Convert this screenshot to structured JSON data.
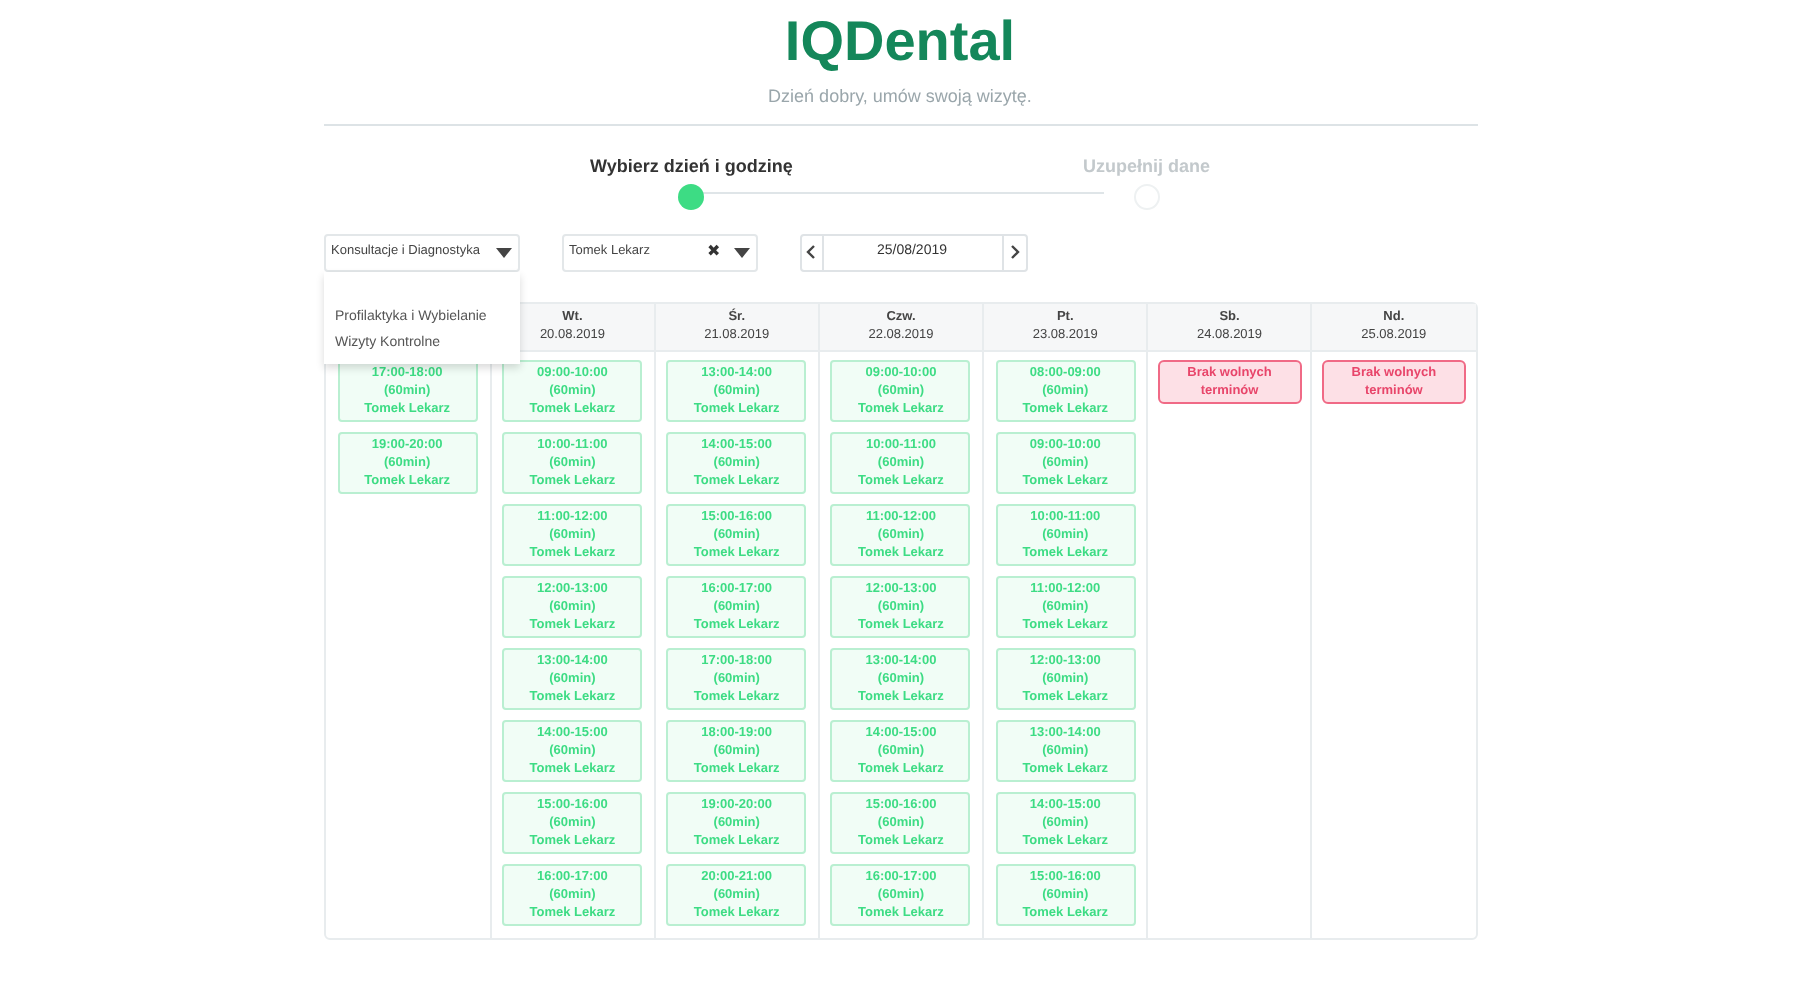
{
  "logo": "IQDental",
  "subtitle": "Dzień dobry, umów swoją wizytę.",
  "steps": [
    {
      "label": "Wybierz dzień i godzinę",
      "selected": true
    },
    {
      "label": "Uzupełnij dane",
      "selected": false
    }
  ],
  "service_select": {
    "value": "Konsultacje i Diagnostyka",
    "expanded": true,
    "options": [
      "Profilaktyka i Wybielanie",
      "Wizyty Kontrolne"
    ]
  },
  "doctor_select": {
    "value": "Tomek Lekarz",
    "clear": "✖"
  },
  "date_picker": {
    "value": "25/08/2019"
  },
  "days": [
    {
      "kind": "slots",
      "slots": [
        {
          "time": "17:00-18:00",
          "duration": "(60min)",
          "doctor": "Tomek Lekarz"
        },
        {
          "time": "19:00-20:00",
          "duration": "(60min)",
          "doctor": "Tomek Lekarz"
        }
      ]
    },
    {
      "kind": "slots",
      "day": "Wt.",
      "date": "20.08.2019",
      "slots": [
        {
          "time": "09:00-10:00",
          "duration": "(60min)",
          "doctor": "Tomek Lekarz"
        },
        {
          "time": "10:00-11:00",
          "duration": "(60min)",
          "doctor": "Tomek Lekarz"
        },
        {
          "time": "11:00-12:00",
          "duration": "(60min)",
          "doctor": "Tomek Lekarz"
        },
        {
          "time": "12:00-13:00",
          "duration": "(60min)",
          "doctor": "Tomek Lekarz"
        },
        {
          "time": "13:00-14:00",
          "duration": "(60min)",
          "doctor": "Tomek Lekarz"
        },
        {
          "time": "14:00-15:00",
          "duration": "(60min)",
          "doctor": "Tomek Lekarz"
        },
        {
          "time": "15:00-16:00",
          "duration": "(60min)",
          "doctor": "Tomek Lekarz"
        },
        {
          "time": "16:00-17:00",
          "duration": "(60min)",
          "doctor": "Tomek Lekarz"
        }
      ]
    },
    {
      "kind": "slots",
      "day": "Śr.",
      "date": "21.08.2019",
      "slots": [
        {
          "time": "13:00-14:00",
          "duration": "(60min)",
          "doctor": "Tomek Lekarz"
        },
        {
          "time": "14:00-15:00",
          "duration": "(60min)",
          "doctor": "Tomek Lekarz"
        },
        {
          "time": "15:00-16:00",
          "duration": "(60min)",
          "doctor": "Tomek Lekarz"
        },
        {
          "time": "16:00-17:00",
          "duration": "(60min)",
          "doctor": "Tomek Lekarz"
        },
        {
          "time": "17:00-18:00",
          "duration": "(60min)",
          "doctor": "Tomek Lekarz"
        },
        {
          "time": "18:00-19:00",
          "duration": "(60min)",
          "doctor": "Tomek Lekarz"
        },
        {
          "time": "19:00-20:00",
          "duration": "(60min)",
          "doctor": "Tomek Lekarz"
        },
        {
          "time": "20:00-21:00",
          "duration": "(60min)",
          "doctor": "Tomek Lekarz"
        }
      ]
    },
    {
      "kind": "slots",
      "day": "Czw.",
      "date": "22.08.2019",
      "slots": [
        {
          "time": "09:00-10:00",
          "duration": "(60min)",
          "doctor": "Tomek Lekarz"
        },
        {
          "time": "10:00-11:00",
          "duration": "(60min)",
          "doctor": "Tomek Lekarz"
        },
        {
          "time": "11:00-12:00",
          "duration": "(60min)",
          "doctor": "Tomek Lekarz"
        },
        {
          "time": "12:00-13:00",
          "duration": "(60min)",
          "doctor": "Tomek Lekarz"
        },
        {
          "time": "13:00-14:00",
          "duration": "(60min)",
          "doctor": "Tomek Lekarz"
        },
        {
          "time": "14:00-15:00",
          "duration": "(60min)",
          "doctor": "Tomek Lekarz"
        },
        {
          "time": "15:00-16:00",
          "duration": "(60min)",
          "doctor": "Tomek Lekarz"
        },
        {
          "time": "16:00-17:00",
          "duration": "(60min)",
          "doctor": "Tomek Lekarz"
        }
      ]
    },
    {
      "kind": "slots",
      "day": "Pt.",
      "date": "23.08.2019",
      "slots": [
        {
          "time": "08:00-09:00",
          "duration": "(60min)",
          "doctor": "Tomek Lekarz"
        },
        {
          "time": "09:00-10:00",
          "duration": "(60min)",
          "doctor": "Tomek Lekarz"
        },
        {
          "time": "10:00-11:00",
          "duration": "(60min)",
          "doctor": "Tomek Lekarz"
        },
        {
          "time": "11:00-12:00",
          "duration": "(60min)",
          "doctor": "Tomek Lekarz"
        },
        {
          "time": "12:00-13:00",
          "duration": "(60min)",
          "doctor": "Tomek Lekarz"
        },
        {
          "time": "13:00-14:00",
          "duration": "(60min)",
          "doctor": "Tomek Lekarz"
        },
        {
          "time": "14:00-15:00",
          "duration": "(60min)",
          "doctor": "Tomek Lekarz"
        },
        {
          "time": "15:00-16:00",
          "duration": "(60min)",
          "doctor": "Tomek Lekarz"
        }
      ]
    },
    {
      "kind": "empty",
      "day": "Sb.",
      "date": "24.08.2019",
      "notice": "Brak wolnych terminów"
    },
    {
      "kind": "empty",
      "day": "Nd.",
      "date": "25.08.2019",
      "notice": "Brak wolnych terminów"
    }
  ]
}
